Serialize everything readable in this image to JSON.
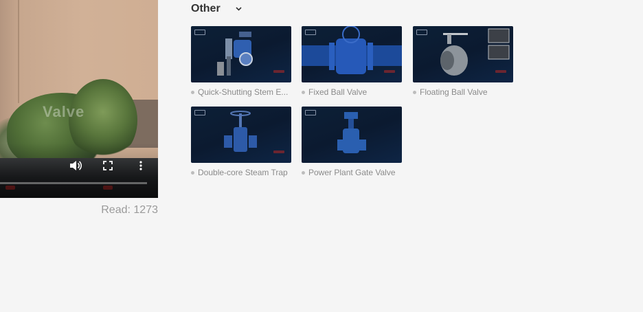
{
  "video": {
    "watermark": "Valve",
    "controls": {
      "volume_icon": "volume-icon",
      "fullscreen_icon": "fullscreen-icon",
      "more_icon": "more-vertical-icon"
    }
  },
  "read": {
    "label": "Read:",
    "count": "1273"
  },
  "other": {
    "title": "Other",
    "toggle_icon": "chevron-down-icon",
    "items": [
      {
        "title": "Quick-Shutting Stem E...",
        "thumb": "quick-shutting-stem-valve"
      },
      {
        "title": "Fixed Ball Valve",
        "thumb": "fixed-ball-valve"
      },
      {
        "title": "Floating Ball Valve",
        "thumb": "floating-ball-valve"
      },
      {
        "title": "Double-core Steam Trap",
        "thumb": "double-core-steam-trap"
      },
      {
        "title": "Power Plant Gate Valve",
        "thumb": "power-plant-gate-valve"
      }
    ]
  }
}
